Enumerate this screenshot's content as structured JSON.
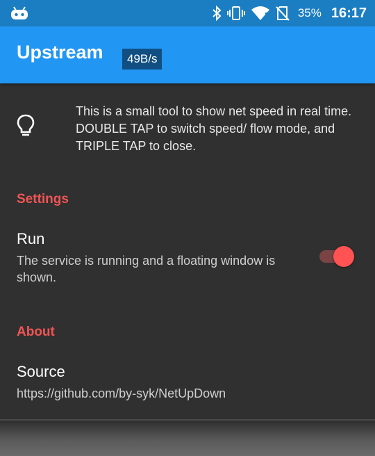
{
  "status_bar": {
    "battery": "35%",
    "time": "16:17",
    "icons": [
      "android-robot-icon",
      "bluetooth-icon",
      "vibrate-icon",
      "wifi-icon",
      "no-sim-icon"
    ]
  },
  "app_bar": {
    "title": "Upstream",
    "speed_badge": "49B/s",
    "color": "#2196F3"
  },
  "info": {
    "icon": "lightbulb-icon",
    "text": "This is a small tool to show net speed in real time. DOUBLE TAP to switch speed/ flow mode, and TRIPLE TAP to close."
  },
  "settings": {
    "header": "Settings",
    "run": {
      "title": "Run",
      "summary": "The service is running and a floating window is shown.",
      "enabled": true
    }
  },
  "about": {
    "header": "About",
    "source": {
      "title": "Source",
      "url": "https://github.com/by-syk/NetUpDown"
    }
  },
  "colors": {
    "accent": "#FF5252",
    "background": "#303030"
  }
}
